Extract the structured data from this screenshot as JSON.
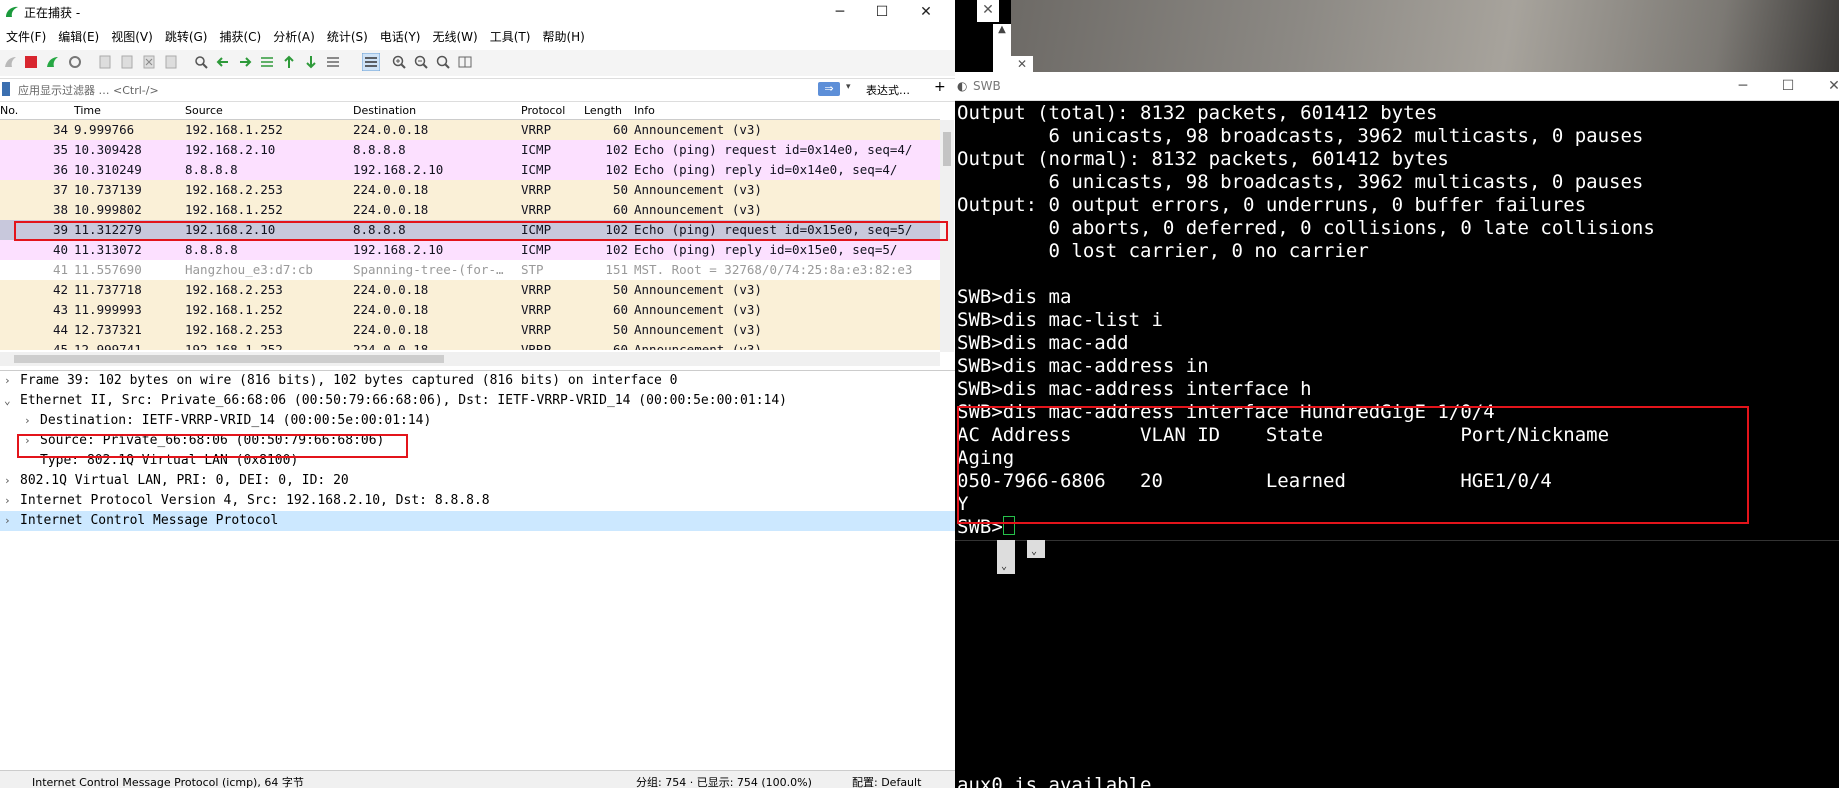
{
  "wireshark": {
    "title": "正在捕获 -",
    "controls": {
      "minimize": "─",
      "maximize": "☐",
      "close": "✕"
    },
    "menu": [
      "文件(F)",
      "编辑(E)",
      "视图(V)",
      "跳转(G)",
      "捕获(C)",
      "分析(A)",
      "统计(S)",
      "电话(Y)",
      "无线(W)",
      "工具(T)",
      "帮助(H)"
    ],
    "filter": {
      "placeholder": "应用显示过滤器 … <Ctrl-/>",
      "arrow": "⇒",
      "dropdown": "▾",
      "expression": "表达式…",
      "add": "+"
    },
    "columns": [
      "No.",
      "Time",
      "Source",
      "Destination",
      "Protocol",
      "Length",
      "Info"
    ],
    "packets": [
      {
        "no": "34",
        "time": "9.999766",
        "src": "192.168.1.252",
        "dst": "224.0.0.18",
        "proto": "VRRP",
        "len": "60",
        "info": "Announcement (v3)",
        "bg": "#faf0d7",
        "fg": "#12121f"
      },
      {
        "no": "35",
        "time": "10.309428",
        "src": "192.168.2.10",
        "dst": "8.8.8.8",
        "proto": "ICMP",
        "len": "102",
        "info": "Echo (ping) request  id=0x14e0, seq=4/",
        "bg": "#fce0ff",
        "fg": "#12121f"
      },
      {
        "no": "36",
        "time": "10.310249",
        "src": "8.8.8.8",
        "dst": "192.168.2.10",
        "proto": "ICMP",
        "len": "102",
        "info": "Echo (ping) reply    id=0x14e0, seq=4/",
        "bg": "#fce0ff",
        "fg": "#12121f"
      },
      {
        "no": "37",
        "time": "10.737139",
        "src": "192.168.2.253",
        "dst": "224.0.0.18",
        "proto": "VRRP",
        "len": "50",
        "info": "Announcement (v3)",
        "bg": "#faf0d7",
        "fg": "#12121f"
      },
      {
        "no": "38",
        "time": "10.999802",
        "src": "192.168.1.252",
        "dst": "224.0.0.18",
        "proto": "VRRP",
        "len": "60",
        "info": "Announcement (v3)",
        "bg": "#faf0d7",
        "fg": "#12121f"
      },
      {
        "no": "39",
        "time": "11.312279",
        "src": "192.168.2.10",
        "dst": "8.8.8.8",
        "proto": "ICMP",
        "len": "102",
        "info": "Echo (ping) request  id=0x15e0, seq=5/",
        "bg": "#c8c8dc",
        "fg": "#12121f"
      },
      {
        "no": "40",
        "time": "11.313072",
        "src": "8.8.8.8",
        "dst": "192.168.2.10",
        "proto": "ICMP",
        "len": "102",
        "info": "Echo (ping) reply    id=0x15e0, seq=5/",
        "bg": "#fce0ff",
        "fg": "#12121f"
      },
      {
        "no": "41",
        "time": "11.557690",
        "src": "Hangzhou_e3:d7:cb",
        "dst": "Spanning-tree-(for-…",
        "proto": "STP",
        "len": "151",
        "info": "MST. Root = 32768/0/74:25:8a:e3:82:e3",
        "bg": "#ffffff",
        "fg": "#9a9a9a"
      },
      {
        "no": "42",
        "time": "11.737718",
        "src": "192.168.2.253",
        "dst": "224.0.0.18",
        "proto": "VRRP",
        "len": "50",
        "info": "Announcement (v3)",
        "bg": "#faf0d7",
        "fg": "#12121f"
      },
      {
        "no": "43",
        "time": "11.999993",
        "src": "192.168.1.252",
        "dst": "224.0.0.18",
        "proto": "VRRP",
        "len": "60",
        "info": "Announcement (v3)",
        "bg": "#faf0d7",
        "fg": "#12121f"
      },
      {
        "no": "44",
        "time": "12.737321",
        "src": "192.168.2.253",
        "dst": "224.0.0.18",
        "proto": "VRRP",
        "len": "50",
        "info": "Announcement (v3)",
        "bg": "#faf0d7",
        "fg": "#12121f"
      },
      {
        "no": "45",
        "time": "12.999741",
        "src": "192.168.1.252",
        "dst": "224.0.0.18",
        "proto": "VRRP",
        "len": "60",
        "info": "Announcement (v3)",
        "bg": "#faf0d7",
        "fg": "#12121f"
      }
    ],
    "details": [
      {
        "arrow": "›",
        "text": "Frame 39: 102 bytes on wire (816 bits), 102 bytes captured (816 bits) on interface 0",
        "indent": 0,
        "bg": "#ffffff"
      },
      {
        "arrow": "⌄",
        "text": "Ethernet II, Src: Private_66:68:06 (00:50:79:66:68:06), Dst: IETF-VRRP-VRID_14 (00:00:5e:00:01:14)",
        "indent": 0,
        "bg": "#ffffff"
      },
      {
        "arrow": "›",
        "text": "Destination: IETF-VRRP-VRID_14 (00:00:5e:00:01:14)",
        "indent": 1,
        "bg": "#ffffff"
      },
      {
        "arrow": "›",
        "text": "Source: Private_66:68:06 (00:50:79:66:68:06)",
        "indent": 1,
        "bg": "#ffffff"
      },
      {
        "arrow": "",
        "text": "Type: 802.1Q Virtual LAN (0x8100)",
        "indent": 1,
        "bg": "#ffffff"
      },
      {
        "arrow": "›",
        "text": "802.1Q Virtual LAN, PRI: 0, DEI: 0, ID: 20",
        "indent": 0,
        "bg": "#ffffff"
      },
      {
        "arrow": "›",
        "text": "Internet Protocol Version 4, Src: 192.168.2.10, Dst: 8.8.8.8",
        "indent": 0,
        "bg": "#ffffff"
      },
      {
        "arrow": "›",
        "text": "Internet Control Message Protocol",
        "indent": 0,
        "bg": "#cce8ff"
      }
    ],
    "status": {
      "left": "Internet Control Message Protocol (icmp), 64 字节",
      "mid": "分组: 754 · 已显示: 754 (100.0%)",
      "right": "配置: Default"
    }
  },
  "terminal": {
    "title": "SWB",
    "controls": {
      "minimize": "─",
      "maximize": "☐",
      "close": "✕"
    },
    "lines": [
      "Output (total): 8132 packets, 601412 bytes",
      "        6 unicasts, 98 broadcasts, 3962 multicasts, 0 pauses",
      "Output (normal): 8132 packets, 601412 bytes",
      "        6 unicasts, 98 broadcasts, 3962 multicasts, 0 pauses",
      "Output: 0 output errors, 0 underruns, 0 buffer failures",
      "        0 aborts, 0 deferred, 0 collisions, 0 late collisions",
      "        0 lost carrier, 0 no carrier",
      "",
      "SWB>dis ma",
      "SWB>dis mac-list i",
      "SWB>dis mac-add",
      "SWB>dis mac-address in",
      "SWB>dis mac-address interface h",
      "SWB>dis mac-address interface HundredGigE 1/0/4",
      "AC Address      VLAN ID    State            Port/Nickname",
      "Aging",
      "050-7966-6806   20         Learned          HGE1/0/4",
      "Y"
    ],
    "prompt": "SWB>",
    "bottom_line": "aux0 is available"
  },
  "colors": {
    "highlight": "#e3141b",
    "cursor": "#26c04a"
  }
}
